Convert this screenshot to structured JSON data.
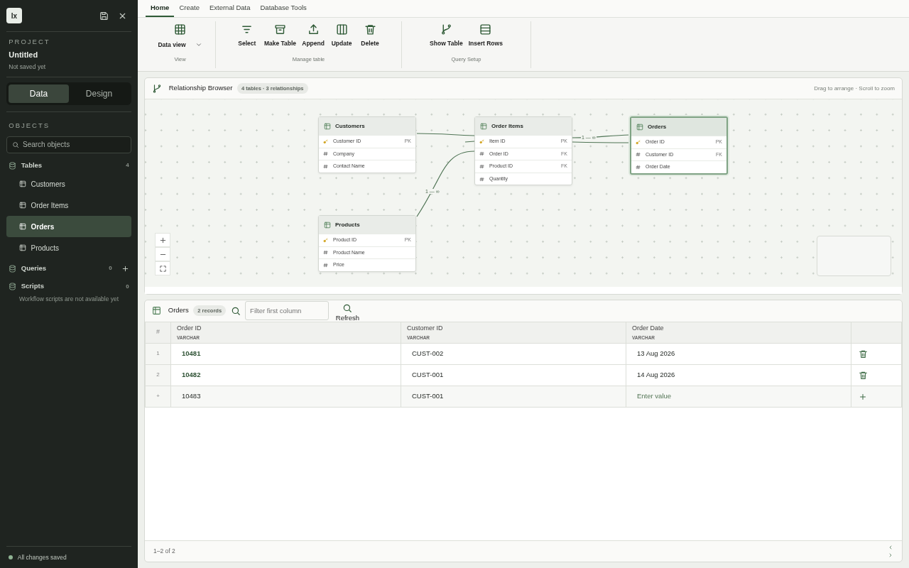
{
  "app": {
    "logo": "Ix"
  },
  "project": {
    "label": "PROJECT",
    "name": "Untitled",
    "status": "Not saved yet"
  },
  "mode_toggle": [
    {
      "label": "Data",
      "selected": true
    },
    {
      "label": "Design",
      "selected": false
    }
  ],
  "objects": {
    "heading": "OBJECTS",
    "search_placeholder": "Search objects",
    "groups": [
      {
        "label": "Tables",
        "count": "4",
        "addable": false,
        "children": [
          {
            "label": "Customers",
            "selected": false
          },
          {
            "label": "Order Items",
            "selected": false
          },
          {
            "label": "Orders",
            "selected": true
          },
          {
            "label": "Products",
            "selected": false
          }
        ]
      },
      {
        "label": "Queries",
        "count": "0",
        "addable": true
      },
      {
        "label": "Scripts",
        "count": "0",
        "addable": false,
        "note": "Workflow scripts are not available yet"
      }
    ]
  },
  "save_status": "All changes saved",
  "ribbon_tabs": [
    {
      "label": "Home",
      "selected": true
    },
    {
      "label": "Create",
      "selected": false
    },
    {
      "label": "External Data",
      "selected": false
    },
    {
      "label": "Database Tools",
      "selected": false
    }
  ],
  "ribbon_groups": [
    {
      "label": "View",
      "buttons": [
        {
          "label": "Data view",
          "kind": "dropdown"
        }
      ]
    },
    {
      "label": "Manage table",
      "buttons": [
        {
          "label": "Select",
          "kind": "plain"
        },
        {
          "label": "Make Table",
          "kind": "plain"
        },
        {
          "label": "Append",
          "kind": "plain"
        },
        {
          "label": "Update",
          "kind": "plain"
        },
        {
          "label": "Delete",
          "kind": "plain"
        }
      ]
    },
    {
      "label": "Query Setup",
      "buttons": [
        {
          "label": "Show Table",
          "kind": "plain"
        },
        {
          "label": "Insert Rows",
          "kind": "plain"
        }
      ]
    }
  ],
  "relationship_browser": {
    "title": "Relationship Browser",
    "badge": "4 tables · 3 relationships",
    "hint": "Drag to arrange · Scroll to zoom",
    "tables": [
      {
        "name": "Customers",
        "selected": false,
        "fields": [
          {
            "name": "Customer ID",
            "kind": "key",
            "tag": "PK"
          },
          {
            "name": "Company",
            "kind": "plain"
          },
          {
            "name": "Contact Name",
            "kind": "plain"
          }
        ]
      },
      {
        "name": "Order Items",
        "selected": false,
        "fields": [
          {
            "name": "Item ID",
            "kind": "key",
            "tag": "PK"
          },
          {
            "name": "Order ID",
            "kind": "plain",
            "tag": "FK"
          },
          {
            "name": "Product ID",
            "kind": "plain",
            "tag": "FK"
          },
          {
            "name": "Quantity",
            "kind": "plain"
          }
        ]
      },
      {
        "name": "Orders",
        "selected": true,
        "fields": [
          {
            "name": "Order ID",
            "kind": "key",
            "tag": "PK"
          },
          {
            "name": "Customer ID",
            "kind": "plain",
            "tag": "FK"
          },
          {
            "name": "Order Date",
            "kind": "plain"
          }
        ]
      },
      {
        "name": "Products",
        "selected": false,
        "fields": [
          {
            "name": "Product ID",
            "kind": "key",
            "tag": "PK"
          },
          {
            "name": "Product Name",
            "kind": "plain"
          },
          {
            "name": "Price",
            "kind": "plain"
          }
        ]
      }
    ],
    "edge_labels": [
      "1 — ∞",
      "1 — ∞"
    ]
  },
  "data_table": {
    "title": "Orders",
    "badge": "2 records",
    "filter_placeholder": "Filter first column",
    "refresh": "Refresh",
    "row_header": "#",
    "columns": [
      {
        "name": "Order ID",
        "type": "VARCHAR"
      },
      {
        "name": "Customer ID",
        "type": "VARCHAR"
      },
      {
        "name": "Order Date",
        "type": "VARCHAR"
      }
    ],
    "rows": [
      {
        "number": "1",
        "cells": [
          "10481",
          "CUST-002",
          "13 Aug 2026"
        ]
      },
      {
        "number": "2",
        "cells": [
          "10482",
          "CUST-001",
          "14 Aug 2026"
        ]
      }
    ],
    "new_row": {
      "marker": "+",
      "cells": [
        "10483",
        "CUST-001"
      ],
      "placeholder": "Enter value"
    },
    "pagination": "1–2 of 2"
  }
}
